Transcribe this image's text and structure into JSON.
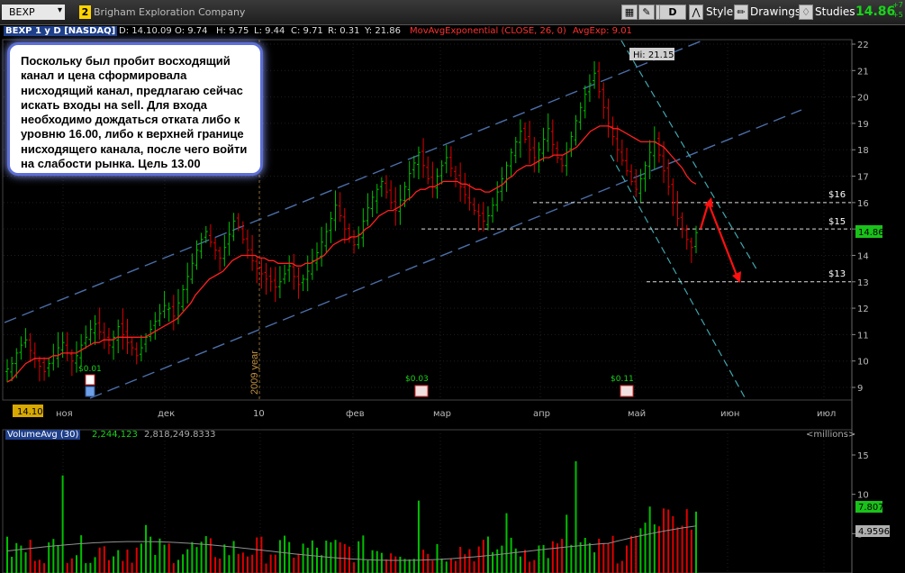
{
  "toolbar": {
    "symbol": "BEXP",
    "link_badge": "2",
    "company": "Brigham Exploration Company",
    "period_button": "D",
    "style_label": "Style",
    "drawings_label": "Drawings",
    "studies_label": "Studies",
    "last_price": "14.86",
    "change_top": "+7",
    "change_bottom": "+5"
  },
  "infobar": {
    "title": "BEXP 1 y D [NASDAQ]",
    "date": "D: 14.10.09",
    "open": "O: 9.74",
    "high": "H: 9.75",
    "low": "L: 9.44",
    "close": "C: 9.71",
    "range": "R: 0.31",
    "y": "Y: 21.86",
    "study": "MovAvgExponential (CLOSE, 26, 0)",
    "avg": "AvgExp: 9.01"
  },
  "note": {
    "text": "Поскольку был пробит восходящий канал и цена сформировала нисходящий канал, предлагаю сейчас искать входы на sell. Для входа необходимо дождаться отката либо к уровню 16.00, либо к верхней границе нисходящего канала, после чего войти на слабости рынка. Цель 13.00"
  },
  "chart": {
    "hi_label": "Hi: 21.15",
    "year_label": "2009 year",
    "current_price": "14.86",
    "level_labels": [
      "$16",
      "$15",
      "$13"
    ],
    "dividend_labels": [
      "$0.01",
      "$0.03",
      "$0.11"
    ],
    "start_date_tag": "14.10",
    "colors": {
      "up": "#00c000",
      "down": "#e00000",
      "ema": "#ff2020",
      "channel_up": "#4b6ea8",
      "channel_down": "#40a8b0",
      "arrow": "#ff1010"
    }
  },
  "volume": {
    "title": "VolumeAvg (30)",
    "value1": "2,244,123",
    "value2": "2,818,249.8333",
    "units": "<millions>",
    "current_tag1": "7.807",
    "current_tag2": "4.9596"
  },
  "chart_data": {
    "type": "candlestick",
    "title": "BEXP 1 y D [NASDAQ]",
    "x_ticks": [
      "ноя",
      "дек",
      "10",
      "фев",
      "мар",
      "апр",
      "май",
      "июн",
      "июл"
    ],
    "price_ylim": [
      8.5,
      22
    ],
    "price_ticks": [
      9,
      10,
      11,
      12,
      13,
      14,
      15,
      16,
      17,
      18,
      19,
      20,
      21,
      22
    ],
    "high": 21.15,
    "last": 14.86,
    "levels": [
      16,
      15,
      13
    ],
    "close_series": [
      9.7,
      9.9,
      10.3,
      10.6,
      10.8,
      10.4,
      10.1,
      9.8,
      9.6,
      9.9,
      10.2,
      10.5,
      10.7,
      10.3,
      10.0,
      10.2,
      10.6,
      10.9,
      11.2,
      11.4,
      11.1,
      10.8,
      10.6,
      10.9,
      11.3,
      11.0,
      10.7,
      10.5,
      10.2,
      10.5,
      10.9,
      11.2,
      11.5,
      11.8,
      12.1,
      12.0,
      11.7,
      12.2,
      12.7,
      13.2,
      13.7,
      14.2,
      14.6,
      14.9,
      14.5,
      14.2,
      13.9,
      14.3,
      14.8,
      15.3,
      15.1,
      14.6,
      14.2,
      13.8,
      13.5,
      13.3,
      13.1,
      13.0,
      12.8,
      13.0,
      13.3,
      13.6,
      13.2,
      12.9,
      13.1,
      13.4,
      13.8,
      14.1,
      14.5,
      14.9,
      15.4,
      15.9,
      15.5,
      15.0,
      14.7,
      14.4,
      14.8,
      15.3,
      15.8,
      16.2,
      16.5,
      16.8,
      16.4,
      16.0,
      15.7,
      16.1,
      16.6,
      17.1,
      17.5,
      17.9,
      17.4,
      16.9,
      16.6,
      17.0,
      17.4,
      17.7,
      17.3,
      16.9,
      16.6,
      16.3,
      16.0,
      15.7,
      15.5,
      15.3,
      15.5,
      15.9,
      16.4,
      16.9,
      17.4,
      17.9,
      18.3,
      18.7,
      18.4,
      18.0,
      17.7,
      18.0,
      18.4,
      18.8,
      18.2,
      17.7,
      17.4,
      17.9,
      18.5,
      19.1,
      19.6,
      20.1,
      20.5,
      20.9,
      20.2,
      19.6,
      19.0,
      18.5,
      18.0,
      17.6,
      17.2,
      16.8,
      16.5,
      16.9,
      17.4,
      17.9,
      18.3,
      17.8,
      17.2,
      16.6,
      16.0,
      15.4,
      15.0,
      14.6,
      14.3,
      14.86
    ],
    "ema_series": [
      9.2,
      9.3,
      9.5,
      9.7,
      9.9,
      10.0,
      10.1,
      10.1,
      10.1,
      10.1,
      10.2,
      10.2,
      10.3,
      10.3,
      10.3,
      10.3,
      10.4,
      10.5,
      10.6,
      10.7,
      10.7,
      10.8,
      10.8,
      10.8,
      10.9,
      10.9,
      10.9,
      10.9,
      10.9,
      10.9,
      10.9,
      11.0,
      11.1,
      11.2,
      11.3,
      11.4,
      11.5,
      11.6,
      11.8,
      12.0,
      12.2,
      12.5,
      12.7,
      12.9,
      13.1,
      13.2,
      13.3,
      13.4,
      13.6,
      13.8,
      13.9,
      14.0,
      14.0,
      14.0,
      14.0,
      13.9,
      13.9,
      13.8,
      13.8,
      13.7,
      13.7,
      13.7,
      13.7,
      13.6,
      13.6,
      13.7,
      13.7,
      13.8,
      13.9,
      14.0,
      14.2,
      14.4,
      14.5,
      14.6,
      14.6,
      14.7,
      14.7,
      14.8,
      15.0,
      15.1,
      15.3,
      15.5,
      15.6,
      15.7,
      15.7,
      15.8,
      15.9,
      16.1,
      16.2,
      16.4,
      16.5,
      16.5,
      16.6,
      16.6,
      16.7,
      16.8,
      16.8,
      16.8,
      16.8,
      16.7,
      16.7,
      16.6,
      16.5,
      16.5,
      16.4,
      16.4,
      16.5,
      16.6,
      16.7,
      16.9,
      17.0,
      17.2,
      17.3,
      17.4,
      17.4,
      17.5,
      17.6,
      17.7,
      17.7,
      17.8,
      17.8,
      17.8,
      17.9,
      18.0,
      18.1,
      18.3,
      18.5,
      18.7,
      18.8,
      18.9,
      18.9,
      18.9,
      18.8,
      18.8,
      18.7,
      18.6,
      18.5,
      18.4,
      18.3,
      18.3,
      18.3,
      18.3,
      18.2,
      18.1,
      17.9,
      17.7,
      17.5,
      17.3,
      17.0,
      16.8,
      16.7
    ],
    "volume_ylim": [
      0,
      15
    ],
    "volume_ticks": [
      5,
      10,
      15
    ],
    "volume_avg_last": 4.9596,
    "volume_last": 7.807
  }
}
